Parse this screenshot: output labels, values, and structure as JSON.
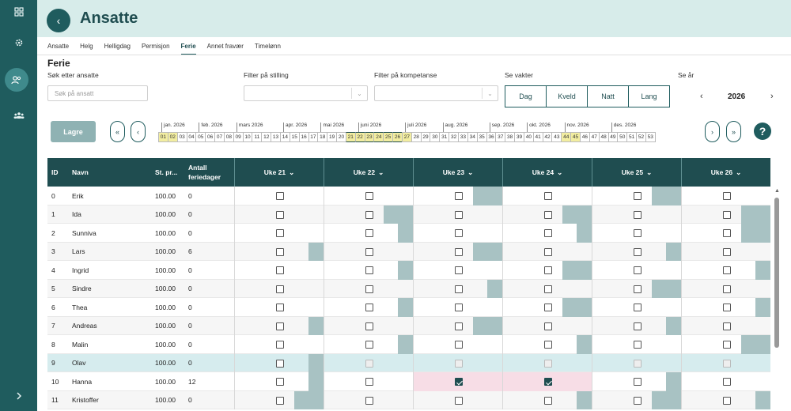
{
  "header": {
    "title": "Ansatte",
    "back_icon": "‹"
  },
  "tabs": [
    {
      "label": "Ansatte",
      "active": false
    },
    {
      "label": "Helg",
      "active": false
    },
    {
      "label": "Helligdag",
      "active": false
    },
    {
      "label": "Permisjon",
      "active": false
    },
    {
      "label": "Ferie",
      "active": true
    },
    {
      "label": "Annet fravær",
      "active": false
    },
    {
      "label": "Timelønn",
      "active": false
    }
  ],
  "section_title": "Ferie",
  "filters": {
    "search_label": "Søk etter ansatte",
    "search_placeholder": "Søk på ansatt",
    "position_label": "Filter på stilling",
    "competence_label": "Filter på kompetanse",
    "shifts_label": "Se vakter",
    "year_label": "Se år",
    "shifts": [
      "Dag",
      "Kveld",
      "Natt",
      "Lang"
    ],
    "year": "2026",
    "prev_year": "‹",
    "next_year": "›"
  },
  "controls": {
    "save_label": "Lagre",
    "first": "«",
    "prev": "‹",
    "next": "›",
    "last": "»",
    "help": "?"
  },
  "months": [
    "jan. 2026",
    "feb. 2026",
    "mars 2026",
    "apr. 2026",
    "mai 2026",
    "juni 2026",
    "juli 2026",
    "aug. 2026",
    "sep. 2026",
    "okt. 2026",
    "nov. 2026",
    "des. 2026"
  ],
  "month_start_weeks": [
    1,
    5,
    9,
    14,
    18,
    22,
    27,
    31,
    36,
    40,
    44,
    49
  ],
  "weeks": [
    "01",
    "02",
    "03",
    "04",
    "05",
    "06",
    "07",
    "08",
    "09",
    "10",
    "11",
    "12",
    "13",
    "14",
    "15",
    "16",
    "17",
    "18",
    "19",
    "20",
    "21",
    "22",
    "23",
    "24",
    "25",
    "26",
    "27",
    "28",
    "29",
    "30",
    "31",
    "32",
    "33",
    "34",
    "35",
    "36",
    "37",
    "38",
    "39",
    "40",
    "41",
    "42",
    "43",
    "44",
    "45",
    "46",
    "47",
    "48",
    "49",
    "50",
    "51",
    "52",
    "53"
  ],
  "highlighted_weeks": [
    "01",
    "02",
    "21",
    "22",
    "23",
    "24",
    "25",
    "26",
    "27",
    "44",
    "45"
  ],
  "selected_weeks": [
    "21",
    "22",
    "23",
    "24",
    "25",
    "26"
  ],
  "table": {
    "columns": {
      "id": "ID",
      "name": "Navn",
      "position": "St. pr...",
      "days": "Antall feriedager"
    },
    "week_columns": [
      "Uke 21",
      "Uke 22",
      "Uke 23",
      "Uke 24",
      "Uke 25",
      "Uke 26"
    ],
    "dropdown_icon": "⌄",
    "rows": [
      {
        "id": "0",
        "name": "Erik",
        "pos": "100.00",
        "days": "0",
        "shade": [
          0,
          0,
          0.33,
          0,
          0.33,
          0
        ],
        "checked": [
          0,
          0,
          0,
          0,
          0,
          0
        ]
      },
      {
        "id": "1",
        "name": "Ida",
        "pos": "100.00",
        "days": "0",
        "shade": [
          0,
          0.33,
          0,
          0.33,
          0,
          0.33
        ],
        "checked": [
          0,
          0,
          0,
          0,
          0,
          0
        ]
      },
      {
        "id": "2",
        "name": "Sunniva",
        "pos": "100.00",
        "days": "0",
        "shade": [
          0,
          0.17,
          0,
          0.17,
          0,
          0.33
        ],
        "checked": [
          0,
          0,
          0,
          0,
          0,
          0
        ]
      },
      {
        "id": "3",
        "name": "Lars",
        "pos": "100.00",
        "days": "6",
        "shade": [
          0.17,
          0,
          0.33,
          0,
          0.17,
          0
        ],
        "checked": [
          0,
          0,
          0,
          0,
          0,
          0
        ]
      },
      {
        "id": "4",
        "name": "Ingrid",
        "pos": "100.00",
        "days": "0",
        "shade": [
          0,
          0.17,
          0,
          0.33,
          0,
          0.17
        ],
        "checked": [
          0,
          0,
          0,
          0,
          0,
          0
        ]
      },
      {
        "id": "5",
        "name": "Sindre",
        "pos": "100.00",
        "days": "0",
        "shade": [
          0,
          0,
          0.17,
          0,
          0.33,
          0
        ],
        "checked": [
          0,
          0,
          0,
          0,
          0,
          0
        ]
      },
      {
        "id": "6",
        "name": "Thea",
        "pos": "100.00",
        "days": "0",
        "shade": [
          0,
          0.17,
          0,
          0.33,
          0,
          0.17
        ],
        "checked": [
          0,
          0,
          0,
          0,
          0,
          0
        ]
      },
      {
        "id": "7",
        "name": "Andreas",
        "pos": "100.00",
        "days": "0",
        "shade": [
          0.17,
          0,
          0.33,
          0,
          0.17,
          0
        ],
        "checked": [
          0,
          0,
          0,
          0,
          0,
          0
        ]
      },
      {
        "id": "8",
        "name": "Malin",
        "pos": "100.00",
        "days": "0",
        "shade": [
          0,
          0.17,
          0,
          0.17,
          0,
          0.33
        ],
        "checked": [
          0,
          0,
          0,
          0,
          0,
          0
        ]
      },
      {
        "id": "9",
        "name": "Olav",
        "pos": "100.00",
        "days": "0",
        "shade": [
          0.17,
          0,
          0,
          0,
          0,
          0
        ],
        "checked": [
          0,
          0,
          0,
          0,
          0,
          0
        ],
        "blue": true
      },
      {
        "id": "10",
        "name": "Hanna",
        "pos": "100.00",
        "days": "12",
        "shade": [
          0.17,
          0,
          0,
          0,
          0.17,
          0
        ],
        "checked": [
          0,
          0,
          1,
          1,
          0,
          0
        ],
        "pink": [
          2,
          3
        ]
      },
      {
        "id": "11",
        "name": "Kristoffer",
        "pos": "100.00",
        "days": "0",
        "shade": [
          0.33,
          0,
          0,
          0.17,
          0.33,
          0.17
        ],
        "checked": [
          0,
          0,
          0,
          0,
          0,
          0
        ]
      }
    ]
  },
  "colors": {
    "brand": "#1f5c5e",
    "header_bg": "#d7ecea",
    "shade": "#a8c2c3",
    "highlight": "#f2eda0",
    "pink": "#f7dde6",
    "blue": "#d6ecee"
  }
}
